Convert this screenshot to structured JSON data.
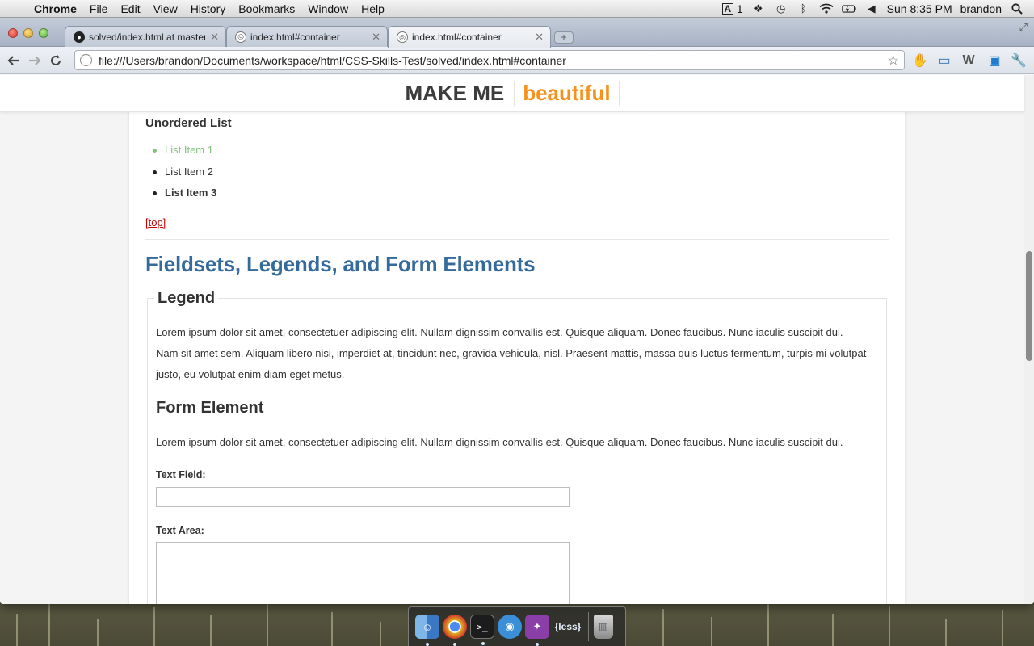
{
  "menubar": {
    "app_name": "Chrome",
    "menus": [
      "File",
      "Edit",
      "View",
      "History",
      "Bookmarks",
      "Window",
      "Help"
    ],
    "adobe_badge": "1",
    "clock": "Sun 8:35 PM",
    "user": "brandon"
  },
  "tabs": [
    {
      "title": "solved/index.html at master",
      "icon": "github-icon"
    },
    {
      "title": "index.html#container",
      "icon": "globe-icon"
    },
    {
      "title": "index.html#container",
      "icon": "globe-icon"
    }
  ],
  "address_bar": {
    "url": "file:///Users/brandon/Documents/workspace/html/CSS-Skills-Test/solved/index.html#container"
  },
  "site_header": {
    "brand_primary": "MAKE ME",
    "brand_accent": "beautiful",
    "accent_color": "#f5921e"
  },
  "content": {
    "unordered_heading": "Unordered List",
    "list_items": [
      "List Item 1",
      "List Item 2",
      "List Item 3"
    ],
    "top_link": "[top]",
    "section_title": "Fieldsets, Legends, and Form Elements",
    "legend": "Legend",
    "paragraph_1": "Lorem ipsum dolor sit amet, consectetuer adipiscing elit. Nullam dignissim convallis est. Quisque aliquam. Donec faucibus. Nunc iaculis suscipit dui. Nam sit amet sem. Aliquam libero nisi, imperdiet at, tincidunt nec, gravida vehicula, nisl. Praesent mattis, massa quis luctus fermentum, turpis mi volutpat justo, eu volutpat enim diam eget metus.",
    "form_heading": "Form Element",
    "paragraph_2": "Lorem ipsum dolor sit amet, consectetuer adipiscing elit. Nullam dignissim convallis est. Quisque aliquam. Donec faucibus. Nunc iaculis suscipit dui.",
    "text_field_label": "Text Field:",
    "text_field_value": "",
    "text_area_label": "Text Area:",
    "text_area_value": ""
  },
  "dock": {
    "apps": [
      "finder",
      "chrome",
      "terminal",
      "facetime",
      "codekit",
      "less",
      "trash"
    ],
    "less_label": "{less}"
  }
}
